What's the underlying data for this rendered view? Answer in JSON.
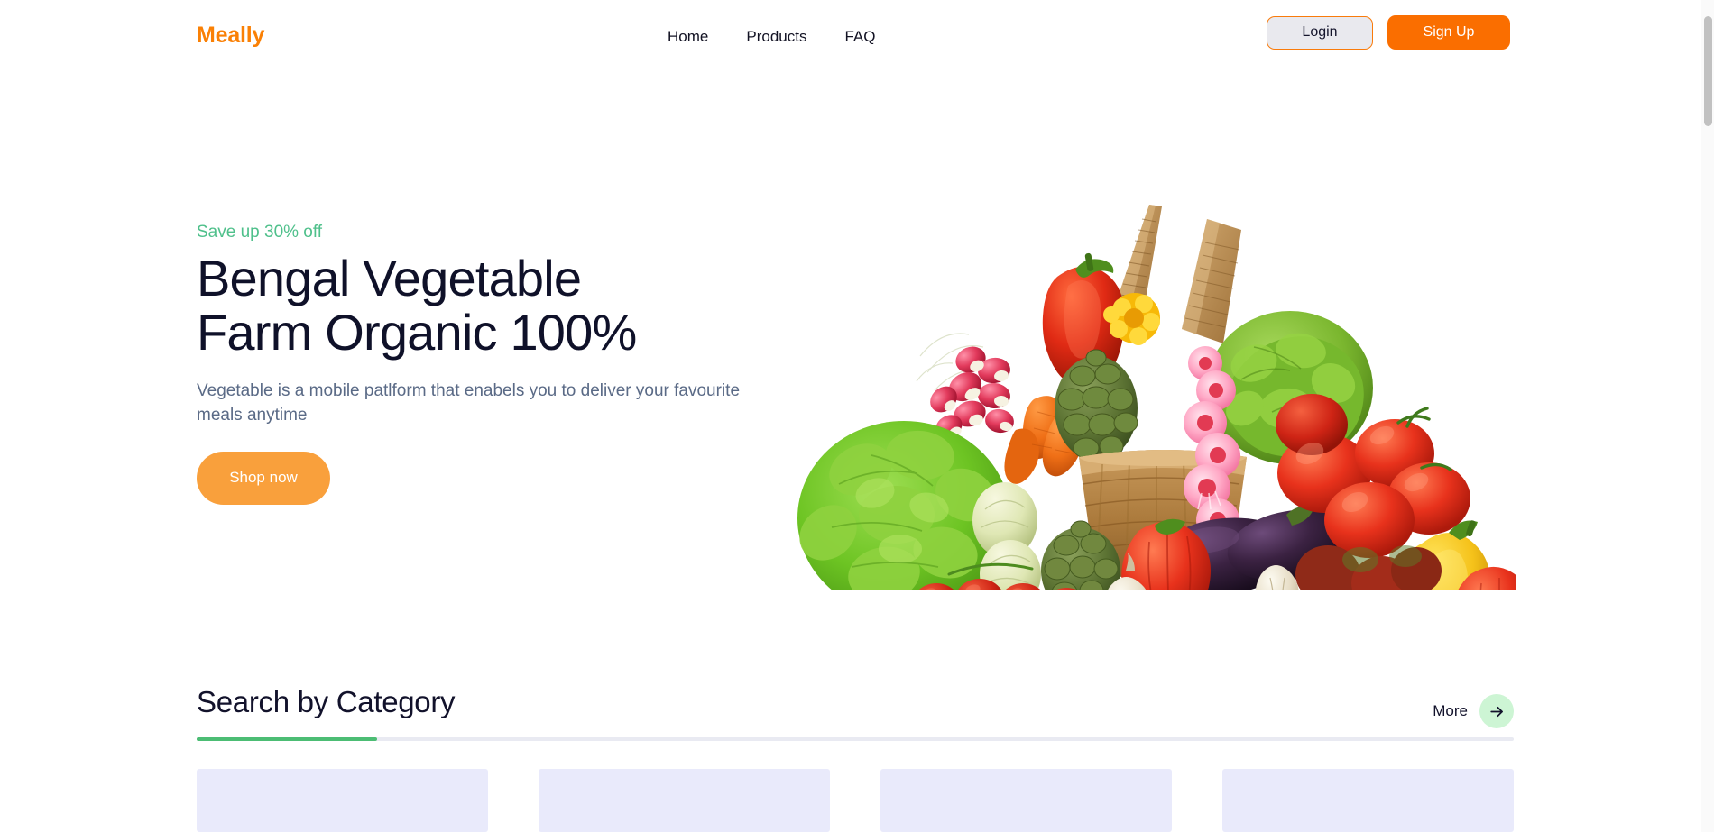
{
  "header": {
    "logo": "Meally",
    "nav": [
      {
        "label": "Home"
      },
      {
        "label": "Products"
      },
      {
        "label": "FAQ"
      }
    ],
    "login_label": "Login",
    "signup_label": "Sign Up"
  },
  "hero": {
    "eyebrow": "Save up 30% off",
    "title_line1": "Bengal Vegetable",
    "title_line2": "Farm Organic 100%",
    "subtitle": "Vegetable is a mobile patlform that enabels you to deliver your favourite meals anytime",
    "cta_label": "Shop now",
    "image_alt": "basket-of-fresh-vegetables"
  },
  "category_section": {
    "title": "Search by Category",
    "more_label": "More",
    "more_icon": "arrow-right-icon",
    "cards": [
      {
        "id": "category-card-1"
      },
      {
        "id": "category-card-2"
      },
      {
        "id": "category-card-3"
      },
      {
        "id": "category-card-4"
      }
    ]
  },
  "colors": {
    "brand_orange": "#fa8005",
    "signup_orange": "#fa6e00",
    "shop_orange": "#f9a03c",
    "accent_green": "#4cbd74",
    "eyebrow_green": "#4fc08b",
    "more_circle_green": "#cdf5d4",
    "heading_navy": "#0f1129",
    "body_gray": "#5a6a86",
    "card_lavender": "#e9eafb",
    "divider_gray": "#e9eaf2"
  }
}
